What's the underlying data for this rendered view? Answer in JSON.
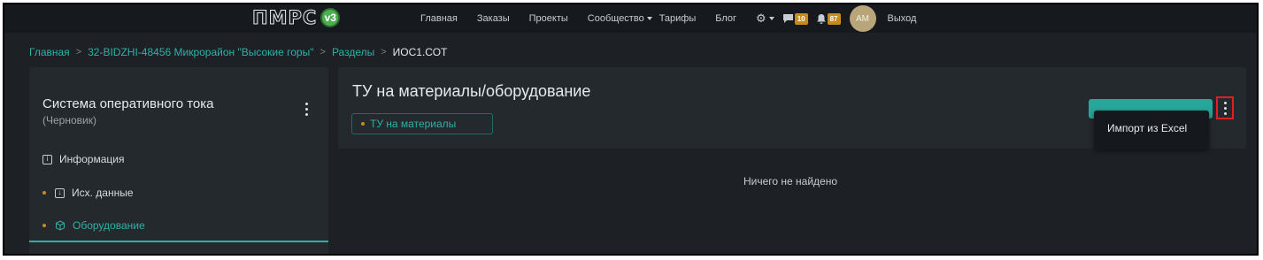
{
  "logo": {
    "text": "ПМРС",
    "version_badge": "v3"
  },
  "topnav": {
    "links": [
      "Главная",
      "Заказы",
      "Проекты",
      "Сообщество",
      "Тарифы",
      "Блог"
    ],
    "settings_icon": "gear-icon",
    "messages_icon": "chat-icon",
    "messages_count": "10",
    "notifications_icon": "bell-icon",
    "notifications_count": "87",
    "avatar_initials": "AM",
    "logout": "Выход"
  },
  "breadcrumb": {
    "items": [
      "Главная",
      "32-BIDZHI-48456 Микрорайон \"Высокие горы\"",
      "Разделы"
    ],
    "current": "ИОС1.СОТ",
    "separator": ">"
  },
  "sidebar": {
    "title": "Система оперативного тока",
    "subtitle": "(Черновик)",
    "items": [
      {
        "label": "Информация",
        "icon": "info-icon"
      },
      {
        "label": "Исх. данные",
        "icon": "download-icon"
      },
      {
        "label": "Оборудование",
        "icon": "cube-icon"
      }
    ]
  },
  "main": {
    "title": "ТУ на материалы/оборудование",
    "tag": "ТУ на материалы",
    "empty_message": "Ничего не найдено"
  },
  "dropdown": {
    "items": [
      "Импорт из Excel"
    ]
  },
  "colors": {
    "accent": "#2ab3a4",
    "badge": "#c98a1d",
    "background": "#1d2126",
    "panel": "#24292e",
    "highlight_border": "#e02020"
  }
}
